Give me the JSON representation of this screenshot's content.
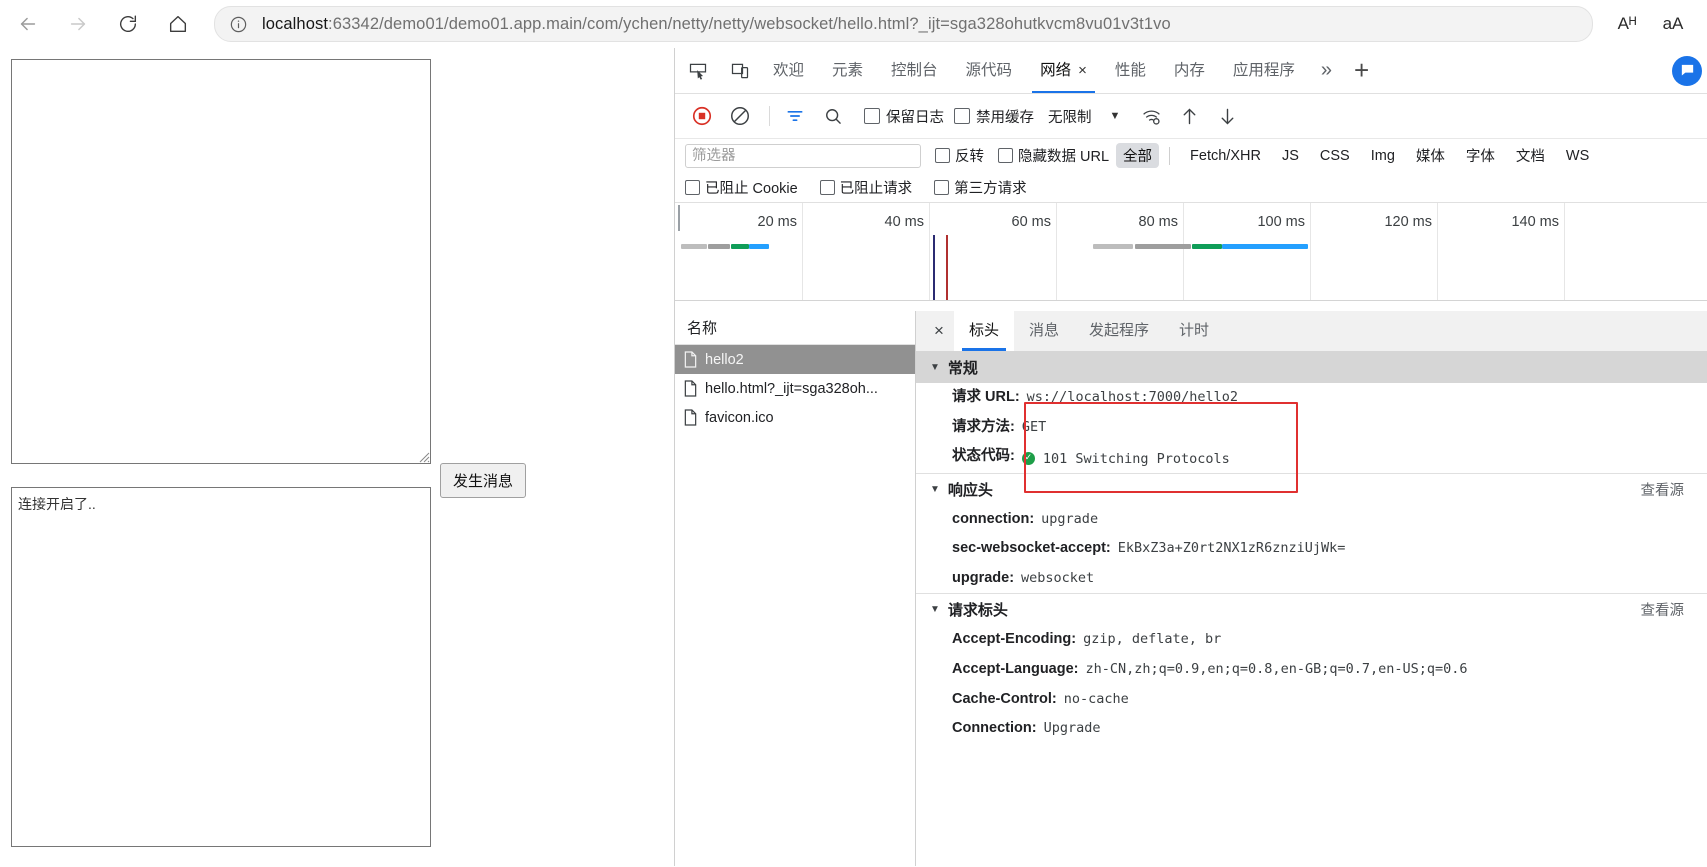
{
  "browser": {
    "back_label": "back-arrow",
    "forward_label": "forward-arrow",
    "reload_label": "reload",
    "home_label": "home",
    "url_host": "localhost",
    "url_rest": ":63342/demo01/demo01.app.main/com/ychen/netty/netty/websocket/hello.html?_ijt=sga328ohutkvcm8vu01v3t1vo",
    "read_aloud_label": "Aᴴ",
    "font_size_label": "aA"
  },
  "page": {
    "send_textarea_value": "",
    "send_button_label": "发生消息",
    "receive_textarea_value": "连接开启了.."
  },
  "devtools": {
    "tabs": [
      {
        "label": "欢迎",
        "active": false
      },
      {
        "label": "元素",
        "active": false
      },
      {
        "label": "控制台",
        "active": false
      },
      {
        "label": "源代码",
        "active": false
      },
      {
        "label": "网络",
        "active": true,
        "close": "×"
      },
      {
        "label": "性能",
        "active": false
      },
      {
        "label": "内存",
        "active": false
      },
      {
        "label": "应用程序",
        "active": false
      }
    ],
    "more_label": "»",
    "plus_label": "+",
    "toolbar": {
      "record_title": "record-stop",
      "clear_title": "clear",
      "filter_title": "filter",
      "search_title": "search",
      "preserve_log_label": "保留日志",
      "preserve_log_checked": false,
      "disable_cache_label": "禁用缓存",
      "disable_cache_checked": false,
      "throttle_value": "无限制",
      "throttle_caret": "▼"
    },
    "filters": {
      "filter_placeholder": "筛选器",
      "filter_value": "",
      "invert_label": "反转",
      "hide_data_url_label": "隐藏数据 URL",
      "types": [
        {
          "label": "全部",
          "active": true
        },
        {
          "label": "Fetch/XHR",
          "active": false
        },
        {
          "label": "JS",
          "active": false
        },
        {
          "label": "CSS",
          "active": false
        },
        {
          "label": "Img",
          "active": false
        },
        {
          "label": "媒体",
          "active": false
        },
        {
          "label": "字体",
          "active": false
        },
        {
          "label": "文档",
          "active": false
        },
        {
          "label": "WS",
          "active": false
        }
      ],
      "blocked_cookies_label": "已阻止 Cookie",
      "blocked_requests_label": "已阻止请求",
      "third_party_label": "第三方请求"
    },
    "overview": {
      "ticks": [
        "20 ms",
        "40 ms",
        "60 ms",
        "80 ms",
        "100 ms",
        "120 ms",
        "140 ms"
      ],
      "dom_content_loaded_color": "#2b2b72",
      "load_color": "#b03030"
    },
    "request_list": {
      "header": "名称",
      "rows": [
        {
          "name": "hello2",
          "selected": true
        },
        {
          "name": "hello.html?_ijt=sga328oh...",
          "selected": false
        },
        {
          "name": "favicon.ico",
          "selected": false
        }
      ]
    },
    "detail": {
      "close_label": "×",
      "tabs": [
        {
          "label": "标头",
          "active": true
        },
        {
          "label": "消息",
          "active": false
        },
        {
          "label": "发起程序",
          "active": false
        },
        {
          "label": "计时",
          "active": false
        }
      ],
      "sections": [
        {
          "title": "常规",
          "view_source": "",
          "rows": [
            {
              "key": "请求 URL:",
              "value": "ws://localhost:7000/hello2"
            },
            {
              "key": "请求方法:",
              "value": "GET"
            },
            {
              "key": "状态代码:",
              "value": "101 Switching Protocols",
              "status": "ok"
            }
          ]
        },
        {
          "title": "响应头",
          "view_source": "查看源",
          "rows": [
            {
              "key": "connection:",
              "value": "upgrade"
            },
            {
              "key": "sec-websocket-accept:",
              "value": "EkBxZ3a+Z0rt2NX1zR6znziUjWk="
            },
            {
              "key": "upgrade:",
              "value": "websocket"
            }
          ]
        },
        {
          "title": "请求标头",
          "view_source": "查看源",
          "rows": [
            {
              "key": "Accept-Encoding:",
              "value": "gzip, deflate, br"
            },
            {
              "key": "Accept-Language:",
              "value": "zh-CN,zh;q=0.9,en;q=0.8,en-GB;q=0.7,en-US;q=0.6"
            },
            {
              "key": "Cache-Control:",
              "value": "no-cache"
            },
            {
              "key": "Connection:",
              "value": "Upgrade"
            }
          ]
        }
      ]
    }
  }
}
